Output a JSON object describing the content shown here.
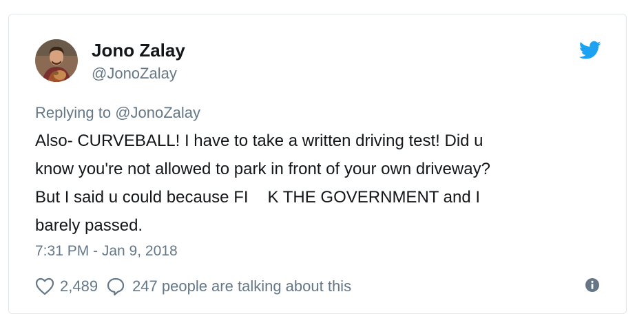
{
  "tweet": {
    "author_name": "Jono Zalay",
    "author_handle": "@JonoZalay",
    "replying_prefix": "Replying to",
    "replying_handle": "@JonoZalay",
    "text_lines": [
      "Also- CURVEBALL! I have to take a written driving test! Did u",
      "know you're not allowed to park in front of your own driveway?",
      "But I said u could because FΙ",
      "K THE GOVERNMENT and I",
      "barely passed."
    ],
    "timestamp": "7:31 PM - Jan 9, 2018",
    "likes": "2,489",
    "talking": "247 people are talking about this"
  },
  "icons": {
    "avatar": "avatar",
    "brand": "twitter-bird-icon",
    "like": "heart-icon",
    "reply": "comment-icon",
    "info": "info-icon"
  },
  "colors": {
    "brand_blue": "#1da1f2",
    "text": "#14171a",
    "muted": "#657786",
    "border": "#e1e8ed"
  }
}
